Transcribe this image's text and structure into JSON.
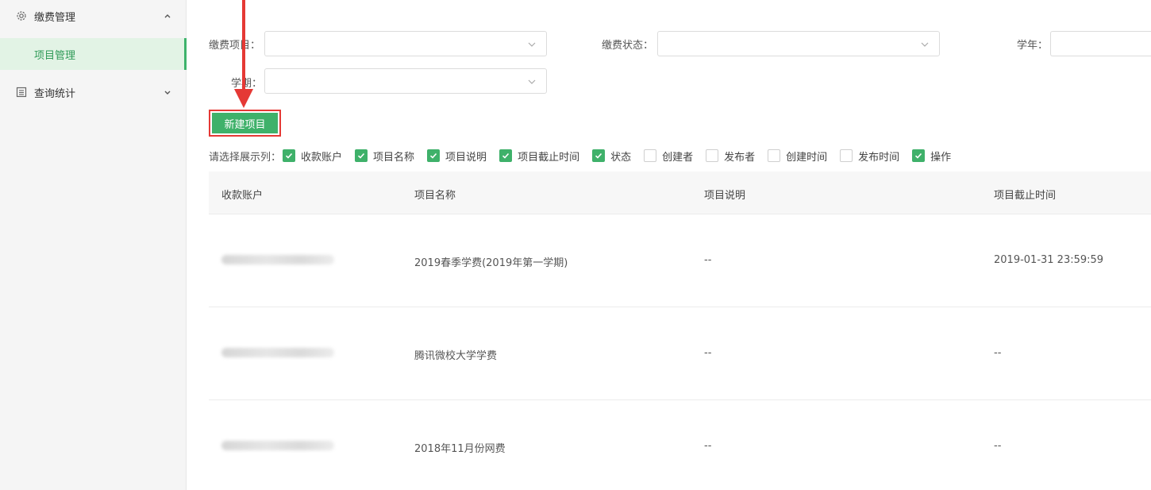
{
  "sidebar": {
    "groups": [
      {
        "label": "缴费管理",
        "icon": "gear-icon",
        "expanded": true
      },
      {
        "label": "查询统计",
        "icon": "list-icon",
        "expanded": false
      }
    ],
    "active_item": "项目管理"
  },
  "filters": {
    "project_label": "缴费项目：",
    "status_label": "缴费状态：",
    "year_label": "学年：",
    "term_label": "学期："
  },
  "toolbar": {
    "new_project_label": "新建项目"
  },
  "column_picker": {
    "label": "请选择展示列：",
    "options": [
      {
        "label": "收款账户",
        "checked": true
      },
      {
        "label": "项目名称",
        "checked": true
      },
      {
        "label": "项目说明",
        "checked": true
      },
      {
        "label": "项目截止时间",
        "checked": true
      },
      {
        "label": "状态",
        "checked": true
      },
      {
        "label": "创建者",
        "checked": false
      },
      {
        "label": "发布者",
        "checked": false
      },
      {
        "label": "创建时间",
        "checked": false
      },
      {
        "label": "发布时间",
        "checked": false
      },
      {
        "label": "操作",
        "checked": true
      }
    ]
  },
  "table": {
    "headers": [
      "收款账户",
      "项目名称",
      "项目说明",
      "项目截止时间"
    ],
    "rows": [
      {
        "name": "2019春季学费(2019年第一学期)",
        "desc": "--",
        "deadline": "2019-01-31 23:59:59"
      },
      {
        "name": "腾讯微校大学学费",
        "desc": "--",
        "deadline": "--"
      },
      {
        "name": "2018年11月份网费",
        "desc": "--",
        "deadline": "--"
      }
    ]
  },
  "colors": {
    "accent": "#3fb16a",
    "annotation": "#e53935",
    "sidebar_active_bg": "#e2f3e5"
  }
}
